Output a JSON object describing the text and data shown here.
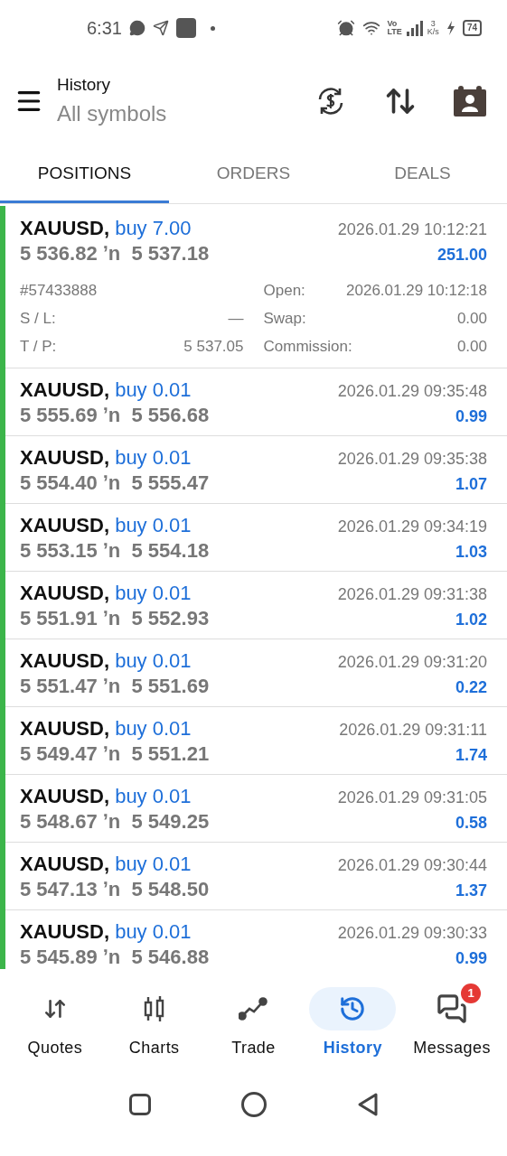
{
  "status_bar": {
    "time": "6:31",
    "network_top": "Vo",
    "network_bottom": "LTE",
    "speed_value": "3",
    "speed_unit": "K/s",
    "battery": "74"
  },
  "header": {
    "title": "History",
    "subtitle": "All symbols"
  },
  "tabs": [
    {
      "label": "POSITIONS",
      "selected": true
    },
    {
      "label": "ORDERS",
      "selected": false
    },
    {
      "label": "DEALS",
      "selected": false
    }
  ],
  "positions": [
    {
      "symbol": "XAUUSD,",
      "trade": "buy 7.00",
      "prices": "5 536.82 ʼn  5 537.18",
      "time": "2026.01.29 10:12:21",
      "profit": "251.00",
      "expanded": true,
      "details": {
        "ticket": "#57433888",
        "open_label": "Open:",
        "open_time": "2026.01.29 10:12:18",
        "sl_label": "S / L:",
        "sl": "—",
        "swap_label": "Swap:",
        "swap": "0.00",
        "tp_label": "T / P:",
        "tp": "5 537.05",
        "commission_label": "Commission:",
        "commission": "0.00"
      }
    },
    {
      "symbol": "XAUUSD,",
      "trade": "buy 0.01",
      "prices": "5 555.69 ʼn  5 556.68",
      "time": "2026.01.29 09:35:48",
      "profit": "0.99",
      "expanded": false
    },
    {
      "symbol": "XAUUSD,",
      "trade": "buy 0.01",
      "prices": "5 554.40 ʼn  5 555.47",
      "time": "2026.01.29 09:35:38",
      "profit": "1.07",
      "expanded": false
    },
    {
      "symbol": "XAUUSD,",
      "trade": "buy 0.01",
      "prices": "5 553.15 ʼn  5 554.18",
      "time": "2026.01.29 09:34:19",
      "profit": "1.03",
      "expanded": false
    },
    {
      "symbol": "XAUUSD,",
      "trade": "buy 0.01",
      "prices": "5 551.91 ʼn  5 552.93",
      "time": "2026.01.29 09:31:38",
      "profit": "1.02",
      "expanded": false
    },
    {
      "symbol": "XAUUSD,",
      "trade": "buy 0.01",
      "prices": "5 551.47 ʼn  5 551.69",
      "time": "2026.01.29 09:31:20",
      "profit": "0.22",
      "expanded": false
    },
    {
      "symbol": "XAUUSD,",
      "trade": "buy 0.01",
      "prices": "5 549.47 ʼn  5 551.21",
      "time": "2026.01.29 09:31:11",
      "profit": "1.74",
      "expanded": false
    },
    {
      "symbol": "XAUUSD,",
      "trade": "buy 0.01",
      "prices": "5 548.67 ʼn  5 549.25",
      "time": "2026.01.29 09:31:05",
      "profit": "0.58",
      "expanded": false
    },
    {
      "symbol": "XAUUSD,",
      "trade": "buy 0.01",
      "prices": "5 547.13 ʼn  5 548.50",
      "time": "2026.01.29 09:30:44",
      "profit": "1.37",
      "expanded": false
    },
    {
      "symbol": "XAUUSD,",
      "trade": "buy 0.01",
      "prices": "5 545.89 ʼn  5 546.88",
      "time": "2026.01.29 09:30:33",
      "profit": "0.99",
      "expanded": false
    }
  ],
  "bottom_nav": [
    {
      "label": "Quotes",
      "kind": "quotes",
      "selected": false
    },
    {
      "label": "Charts",
      "kind": "charts",
      "selected": false
    },
    {
      "label": "Trade",
      "kind": "trade",
      "selected": false
    },
    {
      "label": "History",
      "kind": "history",
      "selected": true
    },
    {
      "label": "Messages",
      "kind": "messages",
      "selected": false,
      "badge": "1"
    }
  ]
}
